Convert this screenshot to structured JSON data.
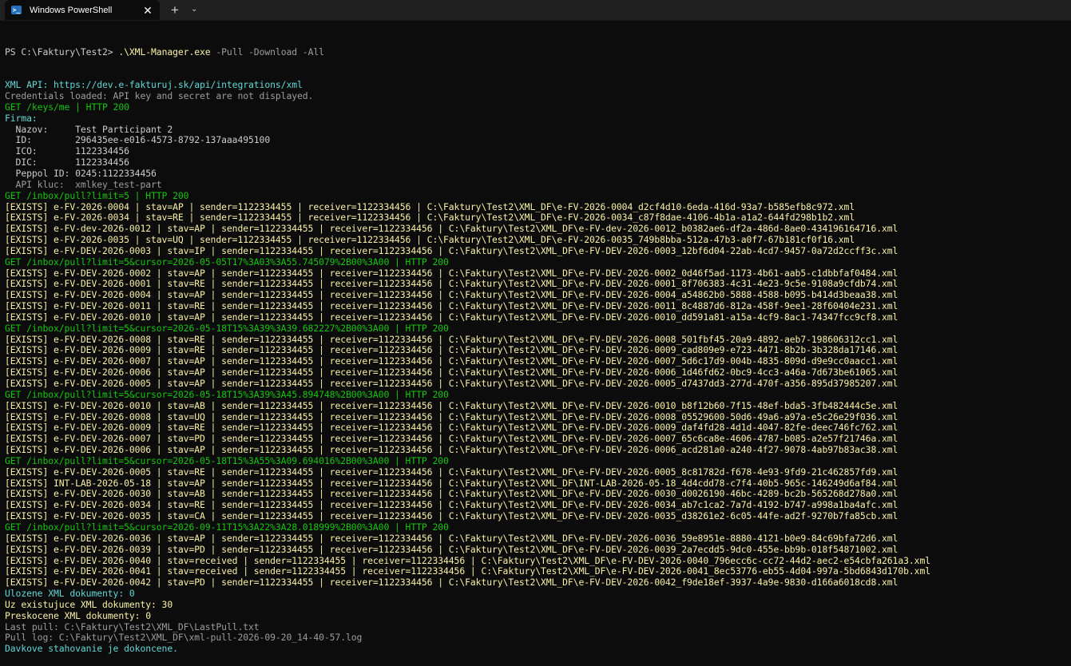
{
  "window": {
    "tab_title": "Windows PowerShell",
    "tab_icon": "powershell-icon",
    "close_icon": "close-icon",
    "new_tab_icon": "plus-icon",
    "dropdown_icon": "chevron-down-icon"
  },
  "colors": {
    "background": "#0c0c0c",
    "titlebar": "#202020",
    "default_text": "#cccccc",
    "cyan": "#61d6d6",
    "gray": "#9d9d9d",
    "green": "#16c60c",
    "yellow": "#f9f1a5"
  },
  "prompt": {
    "path": "PS C:\\Faktury\\Test2> ",
    "command": ".\\XML-Manager.exe",
    "params": " -Pull -Download -All"
  },
  "lines": [
    {
      "text": "XML API: https://dev.e-fakturuj.sk/api/integrations/xml",
      "color": "cyan"
    },
    {
      "text": "Credentials loaded: API key and secret are not displayed.",
      "color": "gray"
    },
    {
      "text": "GET /keys/me | HTTP 200",
      "color": "green"
    },
    {
      "text": "Firma:",
      "color": "cyan"
    },
    {
      "text": "  Nazov:     Test Participant 2",
      "color": "white"
    },
    {
      "text": "  ID:        296435ee-e016-4573-8792-137aaa495100",
      "color": "white"
    },
    {
      "text": "  ICO:       1122334456",
      "color": "white"
    },
    {
      "text": "  DIC:       1122334456",
      "color": "white"
    },
    {
      "text": "  Peppol ID: 0245:1122334456",
      "color": "white"
    },
    {
      "text": "  API kluc:  xmlkey_test-part",
      "color": "gray"
    },
    {
      "text": "GET /inbox/pull?limit=5 | HTTP 200",
      "color": "green"
    },
    {
      "text": "[EXISTS] e-FV-2026-0004 | stav=AP | sender=1122334455 | receiver=1122334456 | C:\\Faktury\\Test2\\XML_DF\\e-FV-2026-0004_d2cf4d10-6eda-416d-93a7-b585efb8c972.xml",
      "color": "yellow"
    },
    {
      "text": "[EXISTS] e-FV-2026-0034 | stav=RE | sender=1122334455 | receiver=1122334456 | C:\\Faktury\\Test2\\XML_DF\\e-FV-2026-0034_c87f8dae-4106-4b1a-a1a2-644fd298b1b2.xml",
      "color": "yellow"
    },
    {
      "text": "[EXISTS] e-FV-dev-2026-0012 | stav=AP | sender=1122334455 | receiver=1122334456 | C:\\Faktury\\Test2\\XML_DF\\e-FV-dev-2026-0012_b0382ae6-df2a-486d-8ae0-434196164716.xml",
      "color": "yellow"
    },
    {
      "text": "[EXISTS] e-FV-2026-0035 | stav=UQ | sender=1122334455 | receiver=1122334456 | C:\\Faktury\\Test2\\XML_DF\\e-FV-2026-0035_749b8bba-512a-47b3-a0f7-67b181cf0f16.xml",
      "color": "yellow"
    },
    {
      "text": "[EXISTS] e-FV-DEV-2026-0003 | stav=IP | sender=1122334455 | receiver=1122334456 | C:\\Faktury\\Test2\\XML_DF\\e-FV-DEV-2026-0003_12bf6d04-22ab-4cd7-9457-0a72d2ccff3c.xml",
      "color": "yellow"
    },
    {
      "text": "GET /inbox/pull?limit=5&cursor=2026-05-05T17%3A03%3A55.745079%2B00%3A00 | HTTP 200",
      "color": "green"
    },
    {
      "text": "[EXISTS] e-FV-DEV-2026-0002 | stav=AP | sender=1122334455 | receiver=1122334456 | C:\\Faktury\\Test2\\XML_DF\\e-FV-DEV-2026-0002_0d46f5ad-1173-4b61-aab5-c1dbbfaf0484.xml",
      "color": "yellow"
    },
    {
      "text": "[EXISTS] e-FV-DEV-2026-0001 | stav=RE | sender=1122334455 | receiver=1122334456 | C:\\Faktury\\Test2\\XML_DF\\e-FV-DEV-2026-0001_8f706383-4c31-4e23-9c5e-9108a9cfdb74.xml",
      "color": "yellow"
    },
    {
      "text": "[EXISTS] e-FV-DEV-2026-0004 | stav=AP | sender=1122334455 | receiver=1122334456 | C:\\Faktury\\Test2\\XML_DF\\e-FV-DEV-2026-0004_a54862b0-5888-4588-b095-b414d3beaa38.xml",
      "color": "yellow"
    },
    {
      "text": "[EXISTS] e-FV-DEV-2026-0011 | stav=RE | sender=1122334455 | receiver=1122334456 | C:\\Faktury\\Test2\\XML_DF\\e-FV-DEV-2026-0011_8c4887d6-812a-458f-9ee1-28f60404e231.xml",
      "color": "yellow"
    },
    {
      "text": "[EXISTS] e-FV-DEV-2026-0010 | stav=AP | sender=1122334455 | receiver=1122334456 | C:\\Faktury\\Test2\\XML_DF\\e-FV-DEV-2026-0010_dd591a81-a15a-4cf9-8ac1-74347fcc9cf8.xml",
      "color": "yellow"
    },
    {
      "text": "GET /inbox/pull?limit=5&cursor=2026-05-18T15%3A39%3A39.682227%2B00%3A00 | HTTP 200",
      "color": "green"
    },
    {
      "text": "[EXISTS] e-FV-DEV-2026-0008 | stav=RE | sender=1122334455 | receiver=1122334456 | C:\\Faktury\\Test2\\XML_DF\\e-FV-DEV-2026-0008_501fbf45-20a9-4892-aeb7-198606312cc1.xml",
      "color": "yellow"
    },
    {
      "text": "[EXISTS] e-FV-DEV-2026-0009 | stav=RE | sender=1122334455 | receiver=1122334456 | C:\\Faktury\\Test2\\XML_DF\\e-FV-DEV-2026-0009_cad809e9-e723-4471-8b2b-3b328da17146.xml",
      "color": "yellow"
    },
    {
      "text": "[EXISTS] e-FV-DEV-2026-0007 | stav=AP | sender=1122334455 | receiver=1122334456 | C:\\Faktury\\Test2\\XML_DF\\e-FV-DEV-2026-0007_5d6c17d9-004b-4835-809d-d9e9cc0aacc1.xml",
      "color": "yellow"
    },
    {
      "text": "[EXISTS] e-FV-DEV-2026-0006 | stav=AP | sender=1122334455 | receiver=1122334456 | C:\\Faktury\\Test2\\XML_DF\\e-FV-DEV-2026-0006_1d46fd62-0bc9-4cc3-a46a-7d673be61065.xml",
      "color": "yellow"
    },
    {
      "text": "[EXISTS] e-FV-DEV-2026-0005 | stav=AP | sender=1122334455 | receiver=1122334456 | C:\\Faktury\\Test2\\XML_DF\\e-FV-DEV-2026-0005_d7437dd3-277d-470f-a356-895d37985207.xml",
      "color": "yellow"
    },
    {
      "text": "GET /inbox/pull?limit=5&cursor=2026-05-18T15%3A39%3A45.894748%2B00%3A00 | HTTP 200",
      "color": "green"
    },
    {
      "text": "[EXISTS] e-FV-DEV-2026-0010 | stav=AB | sender=1122334455 | receiver=1122334456 | C:\\Faktury\\Test2\\XML_DF\\e-FV-DEV-2026-0010_b8f12b60-7f15-48ef-bda5-3fb482444c5e.xml",
      "color": "yellow"
    },
    {
      "text": "[EXISTS] e-FV-DEV-2026-0008 | stav=UQ | sender=1122334455 | receiver=1122334456 | C:\\Faktury\\Test2\\XML_DF\\e-FV-DEV-2026-0008_05529600-50d6-49a6-a97a-e5c26e29f036.xml",
      "color": "yellow"
    },
    {
      "text": "[EXISTS] e-FV-DEV-2026-0009 | stav=RE | sender=1122334455 | receiver=1122334456 | C:\\Faktury\\Test2\\XML_DF\\e-FV-DEV-2026-0009_daf4fd28-4d1d-4047-82fe-deec746fc762.xml",
      "color": "yellow"
    },
    {
      "text": "[EXISTS] e-FV-DEV-2026-0007 | stav=PD | sender=1122334455 | receiver=1122334456 | C:\\Faktury\\Test2\\XML_DF\\e-FV-DEV-2026-0007_65c6ca8e-4606-4787-b085-a2e57f21746a.xml",
      "color": "yellow"
    },
    {
      "text": "[EXISTS] e-FV-DEV-2026-0006 | stav=AP | sender=1122334455 | receiver=1122334456 | C:\\Faktury\\Test2\\XML_DF\\e-FV-DEV-2026-0006_acd281a0-a240-4f27-9078-4ab97b83ac38.xml",
      "color": "yellow"
    },
    {
      "text": "GET /inbox/pull?limit=5&cursor=2026-05-18T15%3A55%3A09.694016%2B00%3A00 | HTTP 200",
      "color": "green"
    },
    {
      "text": "[EXISTS] e-FV-DEV-2026-0005 | stav=RE | sender=1122334455 | receiver=1122334456 | C:\\Faktury\\Test2\\XML_DF\\e-FV-DEV-2026-0005_8c81782d-f678-4e93-9fd9-21c462857fd9.xml",
      "color": "yellow"
    },
    {
      "text": "[EXISTS] INT-LAB-2026-05-18 | stav=AP | sender=1122334455 | receiver=1122334456 | C:\\Faktury\\Test2\\XML_DF\\INT-LAB-2026-05-18_4d4cdd78-c7f4-40b5-965c-146249d6af84.xml",
      "color": "yellow"
    },
    {
      "text": "[EXISTS] e-FV-DEV-2026-0030 | stav=AB | sender=1122334455 | receiver=1122334456 | C:\\Faktury\\Test2\\XML_DF\\e-FV-DEV-2026-0030_d0026190-46bc-4289-bc2b-565268d278a0.xml",
      "color": "yellow"
    },
    {
      "text": "[EXISTS] e-FV-DEV-2026-0034 | stav=RE | sender=1122334455 | receiver=1122334456 | C:\\Faktury\\Test2\\XML_DF\\e-FV-DEV-2026-0034_ab7c1ca2-7a7d-4192-b747-a998a1ba4afc.xml",
      "color": "yellow"
    },
    {
      "text": "[EXISTS] e-FV-DEV-2026-0035 | stav=CA | sender=1122334455 | receiver=1122334456 | C:\\Faktury\\Test2\\XML_DF\\e-FV-DEV-2026-0035_d38261e2-6c05-44fe-ad2f-9270b7fa85cb.xml",
      "color": "yellow"
    },
    {
      "text": "GET /inbox/pull?limit=5&cursor=2026-09-11T15%3A22%3A28.018999%2B00%3A00 | HTTP 200",
      "color": "green"
    },
    {
      "text": "[EXISTS] e-FV-DEV-2026-0036 | stav=AP | sender=1122334455 | receiver=1122334456 | C:\\Faktury\\Test2\\XML_DF\\e-FV-DEV-2026-0036_59e8951e-8880-4121-b0e9-84c69bfa72d6.xml",
      "color": "yellow"
    },
    {
      "text": "[EXISTS] e-FV-DEV-2026-0039 | stav=PD | sender=1122334455 | receiver=1122334456 | C:\\Faktury\\Test2\\XML_DF\\e-FV-DEV-2026-0039_2a7ecdd5-9dc0-455e-bb9b-018f54871002.xml",
      "color": "yellow"
    },
    {
      "text": "[EXISTS] e-FV-DEV-2026-0040 | stav=received | sender=1122334455 | receiver=1122334456 | C:\\Faktury\\Test2\\XML_DF\\e-FV-DEV-2026-0040_796ecc6c-cc72-44d2-aec2-e54cbfa261a3.xml",
      "color": "yellow"
    },
    {
      "text": "[EXISTS] e-FV-DEV-2026-0041 | stav=received | sender=1122334455 | receiver=1122334456 | C:\\Faktury\\Test2\\XML_DF\\e-FV-DEV-2026-0041_8ec53776-eb55-4d04-997a-5bd6843d170b.xml",
      "color": "yellow"
    },
    {
      "text": "[EXISTS] e-FV-DEV-2026-0042 | stav=PD | sender=1122334455 | receiver=1122334456 | C:\\Faktury\\Test2\\XML_DF\\e-FV-DEV-2026-0042_f9de18ef-3937-4a9e-9830-d166a6018cd8.xml",
      "color": "yellow"
    },
    {
      "text": "Ulozene XML dokumenty: 0",
      "color": "cyan"
    },
    {
      "text": "Uz existujuce XML dokumenty: 30",
      "color": "yellow"
    },
    {
      "text": "Preskocene XML dokumenty: 0",
      "color": "yellow"
    },
    {
      "text": "Last pull: C:\\Faktury\\Test2\\XML_DF\\LastPull.txt",
      "color": "gray"
    },
    {
      "text": "Pull log: C:\\Faktury\\Test2\\XML_DF\\xml-pull-2026-09-20_14-40-57.log",
      "color": "gray"
    },
    {
      "text": "Davkove stahovanie je dokoncene.",
      "color": "cyan"
    }
  ]
}
